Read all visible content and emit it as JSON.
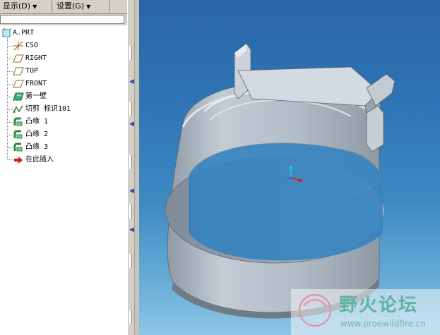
{
  "menu": {
    "show_label": "显示(D)",
    "settings_label": "设置(G)"
  },
  "tree": {
    "items": [
      {
        "label": "A.PRT",
        "icon": "part-icon"
      },
      {
        "label": "CSO",
        "icon": "coordinate-system-icon"
      },
      {
        "label": "RIGHT",
        "icon": "datum-plane-icon"
      },
      {
        "label": "TOP",
        "icon": "datum-plane-icon"
      },
      {
        "label": "FRONT",
        "icon": "datum-plane-icon"
      },
      {
        "label": "第一壁",
        "icon": "first-wall-icon"
      },
      {
        "label": "切剪 标识101",
        "icon": "cut-icon"
      },
      {
        "label": "凸缘 1",
        "icon": "flange-icon"
      },
      {
        "label": "凸缘 2",
        "icon": "flange-icon"
      },
      {
        "label": "凸缘 3",
        "icon": "flange-icon"
      },
      {
        "label": "在此插入",
        "icon": "insert-here-arrow-icon"
      }
    ]
  },
  "watermark": {
    "title": "野火论坛",
    "url": "www.proewildfire.cn"
  },
  "colors": {
    "viewport_top": "#2a66a8",
    "viewport_bottom": "#8cc6e8",
    "model_face": "#a9b4bf",
    "watermark_text": "#5fb3a2"
  }
}
